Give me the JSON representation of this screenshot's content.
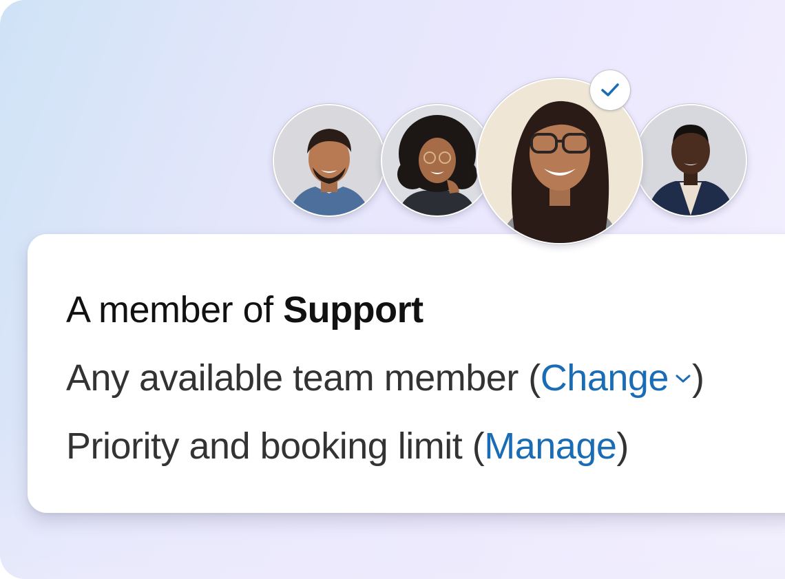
{
  "avatars": [
    {
      "name": "avatar-man-blue-shirt",
      "selected": false
    },
    {
      "name": "avatar-woman-curly-hair",
      "selected": false
    },
    {
      "name": "avatar-woman-glasses",
      "selected": true
    },
    {
      "name": "avatar-man-navy-cardigan",
      "selected": false
    }
  ],
  "card": {
    "line1_prefix": "A member of ",
    "line1_team": "Support",
    "line2_prefix": "Any available team member (",
    "line2_link": "Change",
    "line2_suffix": ")",
    "line3_prefix": "Priority and booking limit (",
    "line3_link": "Manage",
    "line3_suffix": ")"
  },
  "colors": {
    "link": "#1a6cb5",
    "check": "#1a6cb5"
  },
  "icons": {
    "selected_badge": "check-icon",
    "change_dropdown": "chevron-down-icon"
  }
}
